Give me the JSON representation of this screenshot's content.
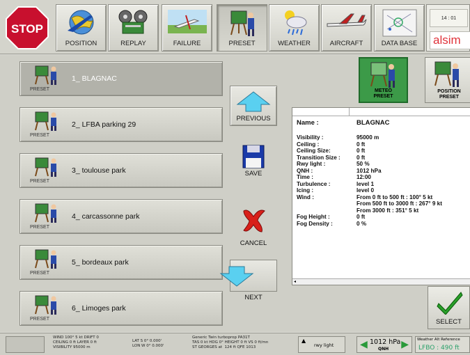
{
  "toolbar": {
    "stop_label": "STOP",
    "buttons": [
      {
        "label": "POSITION"
      },
      {
        "label": "REPLAY"
      },
      {
        "label": "FAILURE"
      },
      {
        "label": "PRESET"
      },
      {
        "label": "WEATHER"
      },
      {
        "label": "AIRCRAFT"
      },
      {
        "label": "DATA BASE"
      }
    ],
    "clock": "14 : 01",
    "brand": "alsim"
  },
  "presets": [
    {
      "tag": "PRESET",
      "name": "1_ BLAGNAC"
    },
    {
      "tag": "PRESET",
      "name": "2_ LFBA parking 29"
    },
    {
      "tag": "PRESET",
      "name": "3_ toulouse park"
    },
    {
      "tag": "PRESET",
      "name": "4_ carcassonne park"
    },
    {
      "tag": "PRESET",
      "name": "5_ bordeaux park"
    },
    {
      "tag": "PRESET",
      "name": "6_ Limoges park"
    }
  ],
  "side": {
    "previous": "PREVIOUS",
    "save": "SAVE",
    "cancel": "CANCEL",
    "next": "NEXT"
  },
  "tabs": {
    "meteo_line1": "METEO",
    "meteo_line2": "PRESET",
    "position_line1": "POSITION",
    "position_line2": "PRESET"
  },
  "info": {
    "name_key": "Name :",
    "name_val": "BLAGNAC",
    "rows": [
      {
        "k": "Visibility :",
        "v": "95000 m"
      },
      {
        "k": "Ceiling :",
        "v": "0 ft"
      },
      {
        "k": "Ceiling Size:",
        "v": "0 ft"
      },
      {
        "k": "Transition Size :",
        "v": "0 ft"
      },
      {
        "k": "Rwy light :",
        "v": "50 %"
      },
      {
        "k": "QNH :",
        "v": "1012 hPa"
      },
      {
        "k": "Time :",
        "v": "12:00"
      },
      {
        "k": "Turbulence :",
        "v": "level 1"
      },
      {
        "k": "Icing :",
        "v": "level 0"
      },
      {
        "k": "Wind :",
        "v": "From 0 ft to 500 ft : 100°  5 kt"
      },
      {
        "k": "",
        "v": "From 500 ft to 3000 ft : 267° 9 kt"
      },
      {
        "k": "",
        "v": "From 3000 ft : 351° 5 kt"
      },
      {
        "k": "Fog Height :",
        "v": "0 ft"
      },
      {
        "k": "Fog Density :",
        "v": "0 %"
      }
    ]
  },
  "select_label": "SELECT",
  "status": {
    "wind": "WIND 100° 5 kt DRIFT 0\nCEILING 0 ft LAYER 0 ft\nVISIBILITY 95000 m",
    "latlon": "LAT S 0° 0.000'\nLON W 0° 0.000'",
    "aircraft": "Generic Twin turboprop PA31T\nTAS 0 kt HDG 0° HEIGHT 0 ft VS 0 ft/mn\nST GEORGES at  124 ft QFE 1013",
    "rwy_light": "rwy light",
    "qnh_value": "1012 hPa",
    "qnh_label": "QNH",
    "alt_ref": "Weather Alt Reference",
    "lfbo": "LFBO : 490 ft"
  }
}
